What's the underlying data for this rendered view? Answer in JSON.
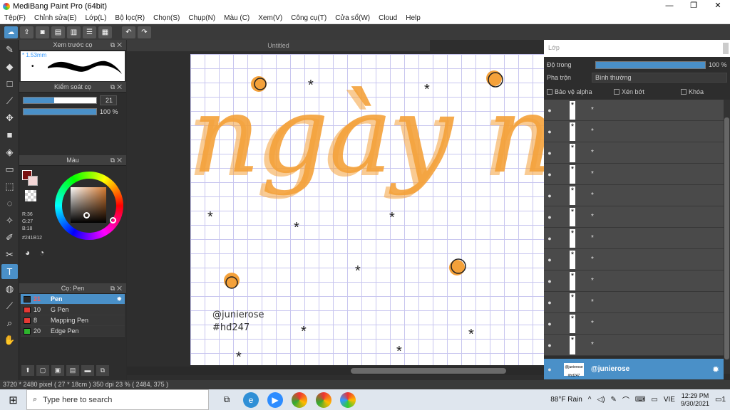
{
  "window": {
    "title": "MediBang Paint Pro (64bit)",
    "minimize": "—",
    "maximize": "❐",
    "close": "✕"
  },
  "menu": [
    "Tệp(F)",
    "Chỉnh sửa(E)",
    "Lớp(L)",
    "Bộ lọc(R)",
    "Chọn(S)",
    "Chụp(N)",
    "Màu (C)",
    "Xem(V)",
    "Công cụ(T)",
    "Cửa sổ(W)",
    "Cloud",
    "Help"
  ],
  "toolbar": {
    "undo_icon": "↶",
    "redo_icon": "↷"
  },
  "panels": {
    "preview_title": "Xem trước cọ",
    "preview_size": "* 1.53mm",
    "brush_control_title": "Kiểm soát cọ",
    "brush_size_value": "21",
    "brush_size_fraction": 0.42,
    "brush_opacity_value": "100 %",
    "brush_opacity_fraction": 1.0,
    "color_title": "Màu",
    "color_r": "R:36",
    "color_g": "G:27",
    "color_b": "B:18",
    "color_hex": "#241B12",
    "brush_title": "Cọ: Pen"
  },
  "brushes": [
    {
      "size": "21",
      "name": "Pen",
      "color": "#2a2a2a",
      "selected": true
    },
    {
      "size": "10",
      "name": "G Pen",
      "color": "#e53935",
      "selected": false
    },
    {
      "size": "8",
      "name": "Mapping Pen",
      "color": "#e53935",
      "selected": false
    },
    {
      "size": "20",
      "name": "Edge Pen",
      "color": "#2db52d",
      "selected": false
    }
  ],
  "canvas": {
    "tab_title": "Untitled",
    "lettering": "ngày ng",
    "credit_line1": "@junierose",
    "credit_line2": "#hđ247",
    "star_glyph": "*"
  },
  "layers": {
    "panel_title": "Lớp",
    "opacity_label": "Độ trong",
    "opacity_value": "100 %",
    "blend_label": "Pha trộn",
    "blend_value": "Bình thường",
    "protect_alpha": "Bảo vệ alpha",
    "clipping": "Xén bớt",
    "lock": "Khóa",
    "items": [
      "*",
      "*",
      "*",
      "*",
      "*",
      "*",
      "*",
      "*",
      "*",
      "*",
      "*",
      "*"
    ],
    "selected_name": "@junierose",
    "selected_thumb": "@junierose #hd247"
  },
  "status": "3720 * 2480 pixel  ( 27 * 18cm )  350 dpi  23 %  ( 2484, 375 )",
  "taskbar": {
    "search_placeholder": "Type here to search",
    "weather": "88°F  Rain",
    "lang": "VIE",
    "time": "12:29 PM",
    "date": "9/30/2021",
    "notif_count": "1"
  }
}
